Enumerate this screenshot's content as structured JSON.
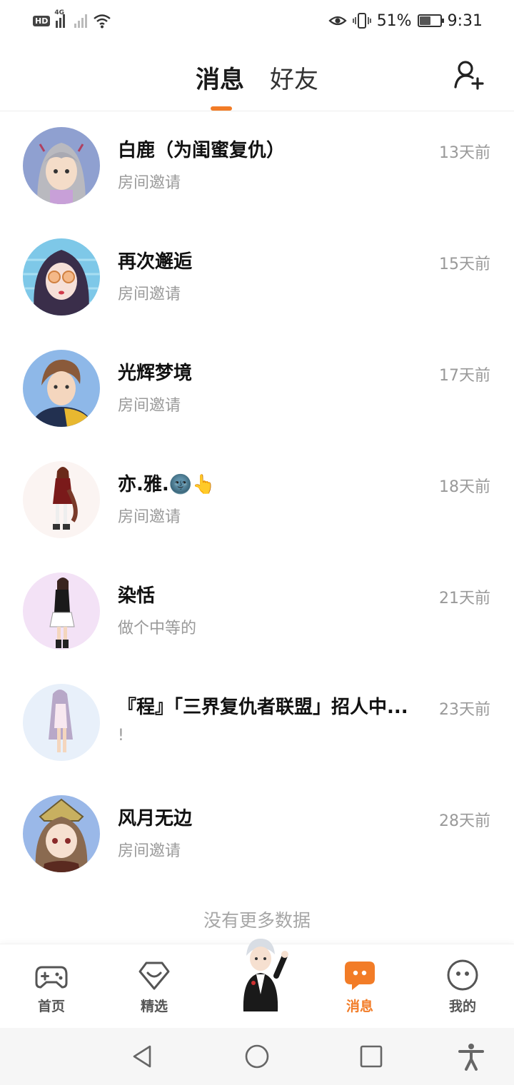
{
  "status_bar": {
    "hd": "HD",
    "network": "4G",
    "battery_percent": "51%",
    "battery_level": 0.51,
    "time": "9:31"
  },
  "header": {
    "tabs": [
      {
        "label": "消息",
        "active": true
      },
      {
        "label": "好友",
        "active": false
      }
    ],
    "add_friend_icon": "add-user-icon"
  },
  "accent_color": "#f27c27",
  "messages": [
    {
      "name": "白鹿（为闺蜜复仇）",
      "preview": "房间邀请",
      "time": "13天前",
      "avatar": "anime-avatar-silver-hair"
    },
    {
      "name": "再次邂逅",
      "preview": "房间邀请",
      "time": "15天前",
      "avatar": "anime-avatar-glasses"
    },
    {
      "name": "光辉梦境",
      "preview": "房间邀请",
      "time": "17天前",
      "avatar": "anime-avatar-boy"
    },
    {
      "name": "亦.雅.🌚👆",
      "preview": "房间邀请",
      "time": "18天前",
      "avatar": "anime-avatar-red-dress"
    },
    {
      "name": "染恬",
      "preview": "做个中等的",
      "time": "21天前",
      "avatar": "anime-avatar-black-top"
    },
    {
      "name": "『程』「三界复仇者联盟」招人中...",
      "preview": "!",
      "time": "23天前",
      "avatar": "anime-avatar-lilac-hair"
    },
    {
      "name": "风月无边",
      "preview": "房间邀请",
      "time": "28天前",
      "avatar": "anime-avatar-crown"
    }
  ],
  "footer_text": "没有更多数据",
  "bottom_nav": [
    {
      "label": "首页",
      "icon": "gamepad-icon",
      "active": false
    },
    {
      "label": "精选",
      "icon": "heart-gem-icon",
      "active": false
    },
    {
      "label": "",
      "icon": "mascot-character",
      "active": false
    },
    {
      "label": "消息",
      "icon": "chat-bubble-icon",
      "active": true
    },
    {
      "label": "我的",
      "icon": "smiley-face-icon",
      "active": false
    }
  ],
  "system_nav": [
    "back-icon",
    "home-icon",
    "recents-icon",
    "accessibility-icon"
  ]
}
